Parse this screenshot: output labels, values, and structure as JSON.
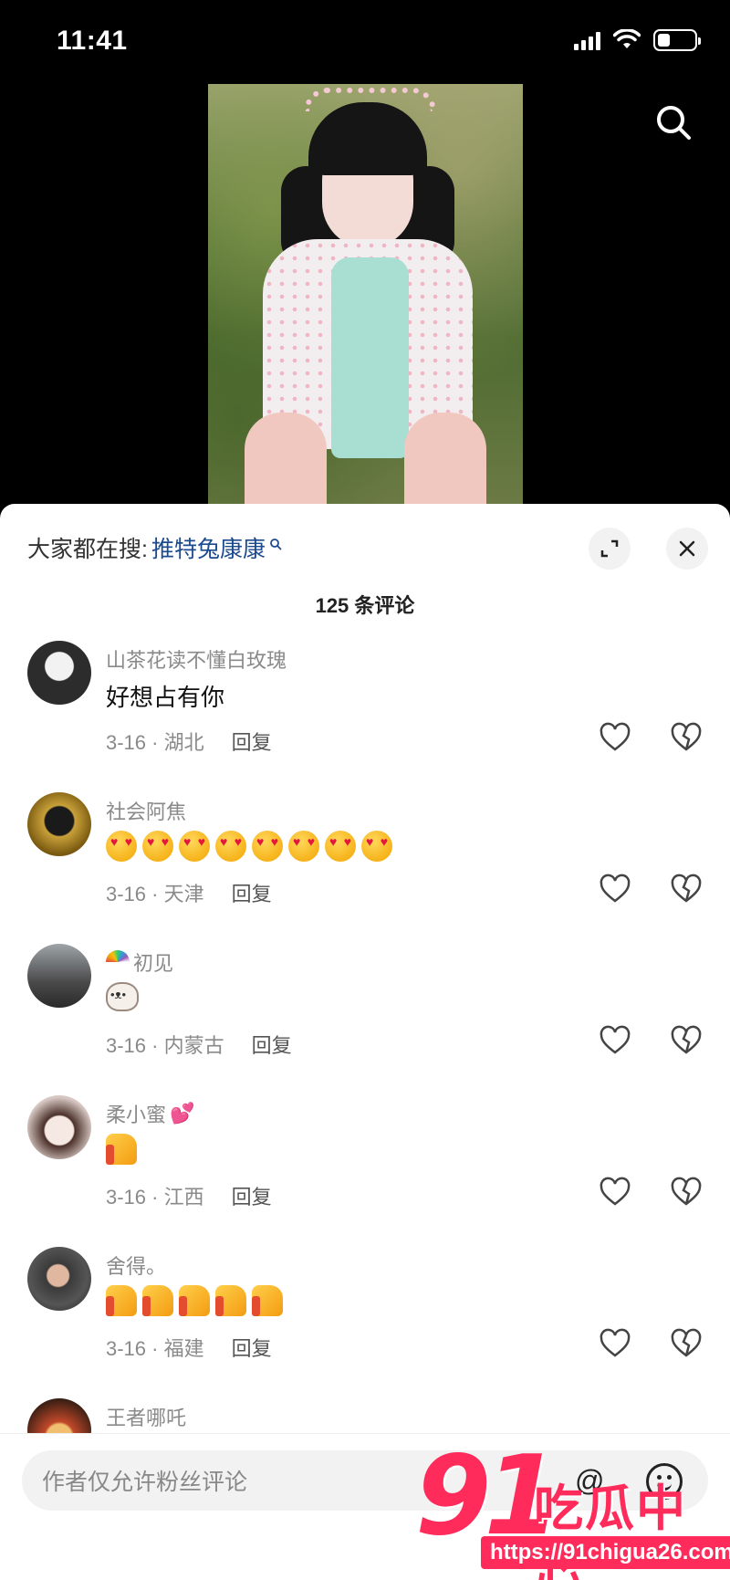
{
  "status_bar": {
    "time": "11:41"
  },
  "hot_search": {
    "prefix": "大家都在搜:",
    "term": "推特兔康康"
  },
  "comment_count": "125 条评论",
  "comments": [
    {
      "username": "山茶花读不懂白玫瑰",
      "text": "好想占有你",
      "meta": "3-16 · 湖北",
      "reply": "回复",
      "avatar_color": "#2c2c2c"
    },
    {
      "username": "社会阿焦",
      "emoji": "heart-eyes x8",
      "meta": "3-16 · 天津",
      "reply": "回复",
      "avatar_color": "#7a5a10"
    },
    {
      "username": "初见",
      "badge": "rainbow",
      "emoji": "cat",
      "meta": "3-16 · 内蒙古",
      "reply": "回复",
      "avatar_color": "#4a4a4a"
    },
    {
      "username": "柔小蜜",
      "badge": "💕",
      "emoji": "thumbs-up x1",
      "meta": "3-16 · 江西",
      "reply": "回复",
      "avatar_color": "#d8c8c4"
    },
    {
      "username": "舍得。",
      "emoji": "thumbs-up x5",
      "meta": "3-16 · 福建",
      "reply": "回复",
      "avatar_color": "#3a3a3a"
    },
    {
      "username": "王者哪吒",
      "avatar_color": "#c2482a"
    }
  ],
  "input": {
    "placeholder": "作者仅允许粉丝评论",
    "at_symbol": "@"
  },
  "watermark": {
    "number": "91",
    "text": "吃瓜中心",
    "url": "https://91chigua26.com"
  }
}
